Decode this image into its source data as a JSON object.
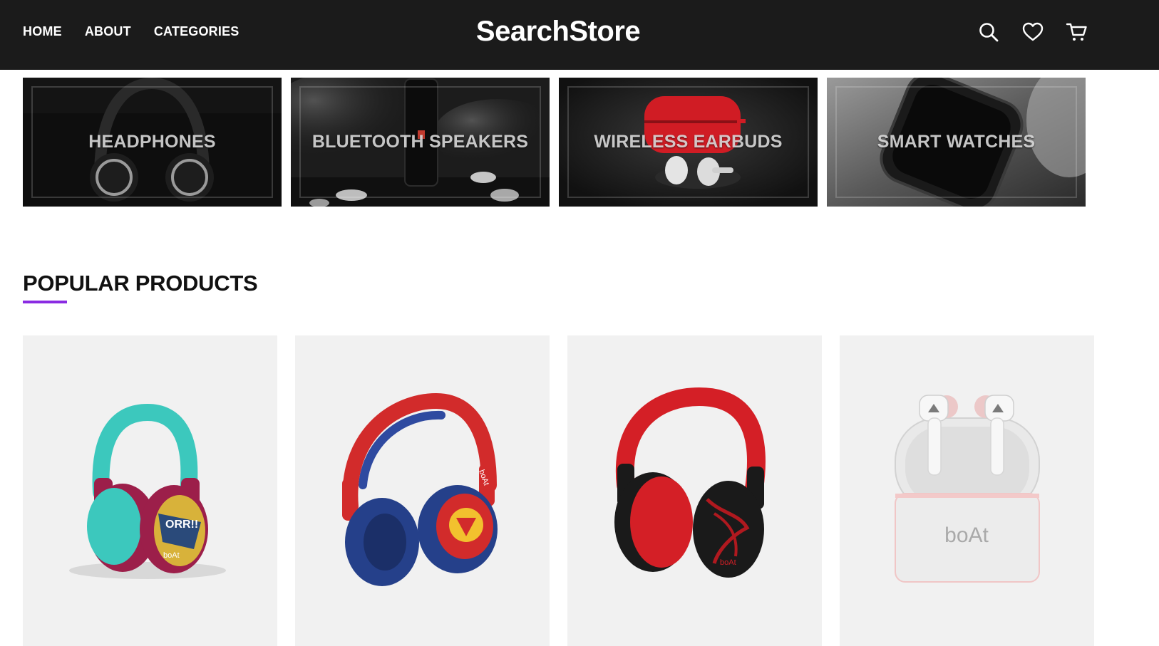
{
  "header": {
    "nav": [
      "HOME",
      "ABOUT",
      "CATEGORIES"
    ],
    "brand": "SearchStore",
    "icons": [
      "search-icon",
      "heart-icon",
      "cart-icon"
    ]
  },
  "categories": [
    {
      "label": "HEADPHONES"
    },
    {
      "label": "BLUETOOTH SPEAKERS"
    },
    {
      "label": "WIRELESS EARBUDS"
    },
    {
      "label": "SMART WATCHES"
    }
  ],
  "popular": {
    "title": "POPULAR PRODUCTS",
    "accent": "#8a2be2",
    "products": [
      {
        "image": "teal-maroon-comic-headphones",
        "brand_mark": "boAt"
      },
      {
        "image": "red-blue-superman-headphones",
        "brand_mark": "boAt"
      },
      {
        "image": "red-black-headphones",
        "brand_mark": "boAt"
      },
      {
        "image": "white-pink-earbuds-case",
        "brand_mark": "boAt"
      }
    ]
  },
  "colors": {
    "header_bg": "#1b1b1b",
    "card_bg": "#f1f1f1"
  }
}
